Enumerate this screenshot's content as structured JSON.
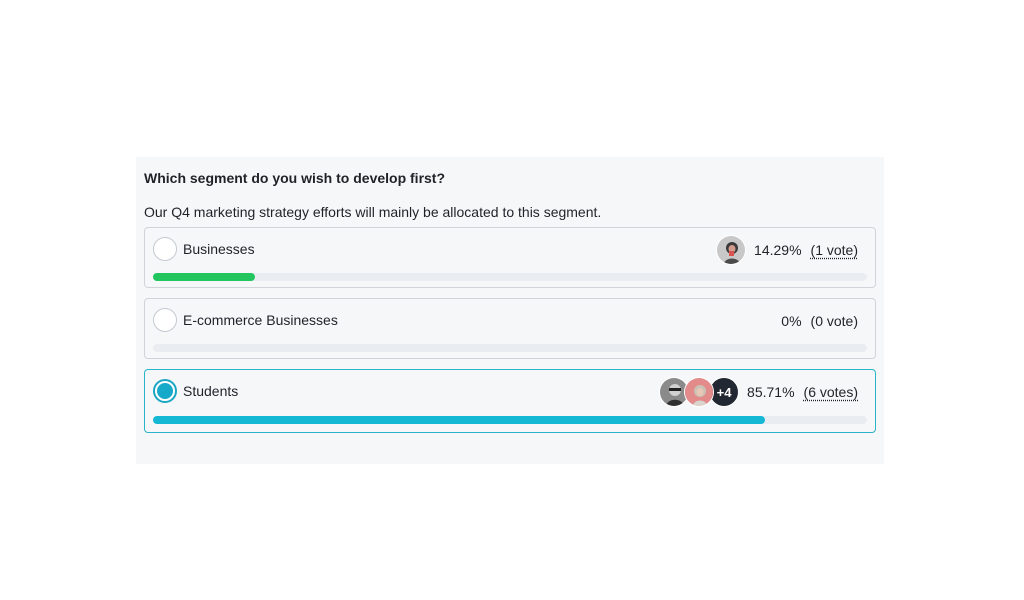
{
  "poll": {
    "question": "Which segment do you wish to develop first?",
    "description": "Our Q4 marketing strategy efforts will mainly be allocated to this segment.",
    "options": [
      {
        "label": "Businesses",
        "percent": "14.29%",
        "votes": "(1 vote)",
        "fraction": 0.1429,
        "bar_color": "#22c55e",
        "selected": false,
        "more": ""
      },
      {
        "label": "E-commerce Businesses",
        "percent": "0%",
        "votes": "(0 vote)",
        "fraction": 0,
        "bar_color": "#22c55e",
        "selected": false,
        "more": ""
      },
      {
        "label": "Students",
        "percent": "85.71%",
        "votes": "(6 votes)",
        "fraction": 0.8571,
        "bar_color": "#14b8d4",
        "selected": true,
        "more": "+4"
      }
    ]
  }
}
